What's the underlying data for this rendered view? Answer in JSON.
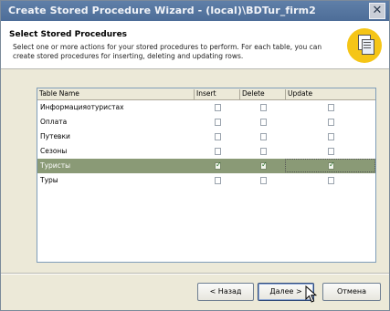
{
  "window": {
    "title": "Create Stored Procedure Wizard - (local)\\BDTur_firm2",
    "close_glyph": "✕"
  },
  "header": {
    "title": "Select Stored Procedures",
    "description": "Select one or more actions for your stored procedures to perform. For each table, you can create stored procedures for inserting, deleting and updating rows.",
    "icon": "stored-procedure-wizard-icon"
  },
  "table": {
    "columns": [
      "Table Name",
      "Insert",
      "Delete",
      "Update"
    ],
    "rows": [
      {
        "name": "Информацияотуристах",
        "insert": false,
        "delete": false,
        "update": false
      },
      {
        "name": "Оплата",
        "insert": false,
        "delete": false,
        "update": false
      },
      {
        "name": "Путевки",
        "insert": false,
        "delete": false,
        "update": false
      },
      {
        "name": "Сезоны",
        "insert": false,
        "delete": false,
        "update": false
      },
      {
        "name": "Туристы",
        "insert": true,
        "delete": true,
        "update": true,
        "selected": true
      },
      {
        "name": "Туры",
        "insert": false,
        "delete": false,
        "update": false
      }
    ]
  },
  "buttons": {
    "back": "< Назад",
    "next": "Далее >",
    "cancel": "Отмена"
  },
  "colors": {
    "titlebar": "#5f7fa8",
    "selection": "#8a9a76",
    "header_icon": "#f5c516"
  }
}
